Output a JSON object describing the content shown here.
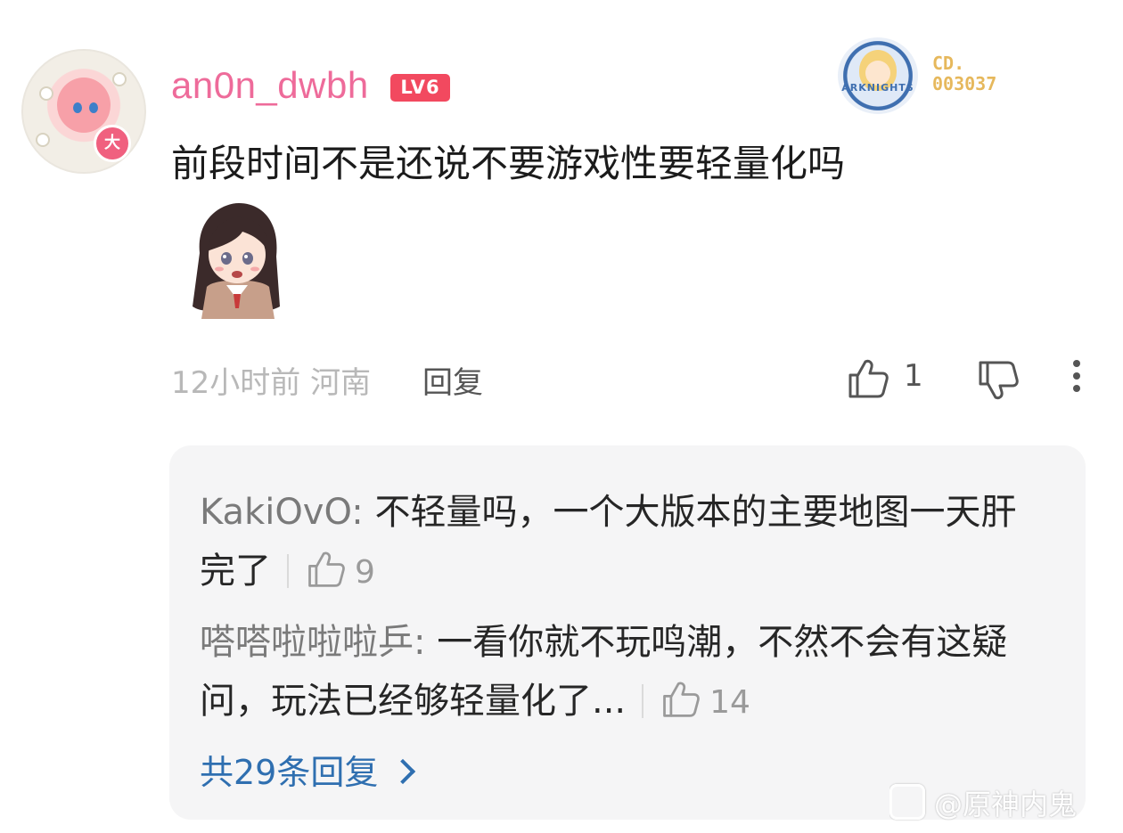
{
  "comment": {
    "username": "an0n_dwbh",
    "level_badge": "LV6",
    "avatar_badge": "大",
    "decoration": {
      "badge_text": "ARKNIGHTS",
      "code_line1": "CD.",
      "code_line2": "003037"
    },
    "text": "前段时间不是还说不要游戏性要轻量化吗",
    "time_location": "12小时前 河南",
    "reply_label": "回复",
    "like_count": "1"
  },
  "replies": {
    "items": [
      {
        "author": "KakiOvO: ",
        "text": "不轻量吗，一个大版本的主要地图一天肝完了",
        "like_count": "9"
      },
      {
        "author": "嗒嗒啦啦啦乒: ",
        "text": "一看你就不玩鸣潮，不然不会有这疑问，玩法已经够轻量化了...",
        "like_count": "14"
      }
    ],
    "total_label": "共29条回复"
  },
  "watermark": {
    "text": "@原神内鬼"
  },
  "colors": {
    "username": "#ee6b9a",
    "level_badge": "#f2495f",
    "link": "#2f6fb0",
    "reply_bg": "#f5f5f6"
  },
  "icons": {
    "like": "thumbs-up-icon",
    "dislike": "thumbs-down-icon",
    "more": "more-vertical-icon",
    "chevron": "chevron-right-icon"
  }
}
